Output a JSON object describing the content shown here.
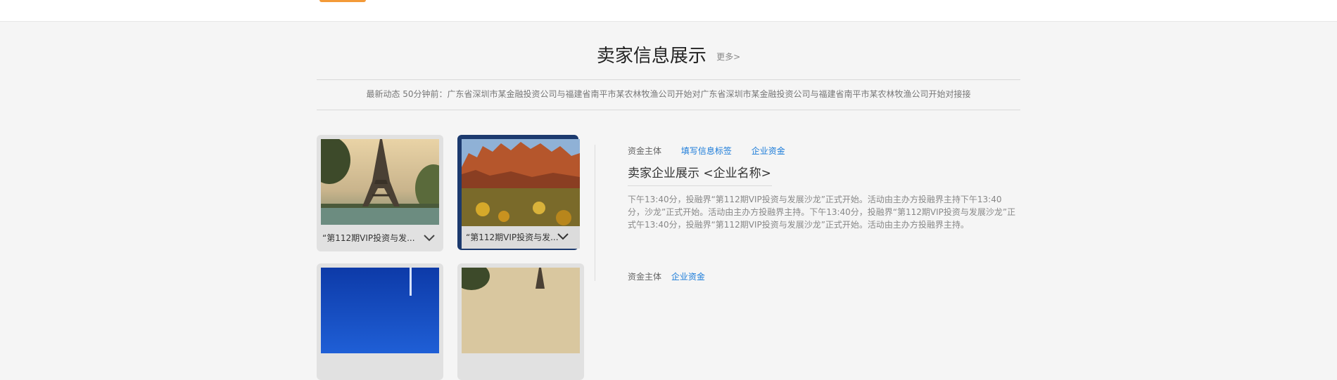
{
  "section": {
    "title": "卖家信息展示",
    "more": "更多>"
  },
  "news": {
    "text": "最新动态 50分钟前：广东省深圳市某金融投资公司与福建省南平市某农林牧渔公司开始对广东省深圳市某金融投资公司与福建省南平市某农林牧渔公司开始对接接"
  },
  "cards": [
    {
      "caption": "“第112期VIP投资与发...",
      "image": "eiffel-tower-photo",
      "active": false
    },
    {
      "caption": "“第112期VIP投资与发...",
      "image": "red-rock-mountain-photo",
      "active": true
    },
    {
      "caption": "",
      "image": "blue-city-photo",
      "active": false
    },
    {
      "caption": "",
      "image": "eiffel-tower-photo",
      "active": false
    }
  ],
  "info": {
    "tags": [
      "资金主体",
      "填写信息标签",
      "企业资金"
    ],
    "company_title": "卖家企业展示  <企业名称>",
    "description": "下午13:40分，投融界“第112期VIP投资与发展沙龙”正式开始。活动由主办方投融界主持下午13:40分，沙龙”正式开始。活动由主办方投融界主持。下午13:40分，投融界“第112期VIP投资与发展沙龙”正式午13:40分，投融界“第112期VIP投资与发展沙龙”正式开始。活动由主办方投融界主持。",
    "tags_2": [
      "资金主体",
      "企业资金"
    ]
  },
  "colors": {
    "accent": "#f39a38",
    "active_border": "#1c3a6e",
    "link": "#1a7bd9"
  }
}
